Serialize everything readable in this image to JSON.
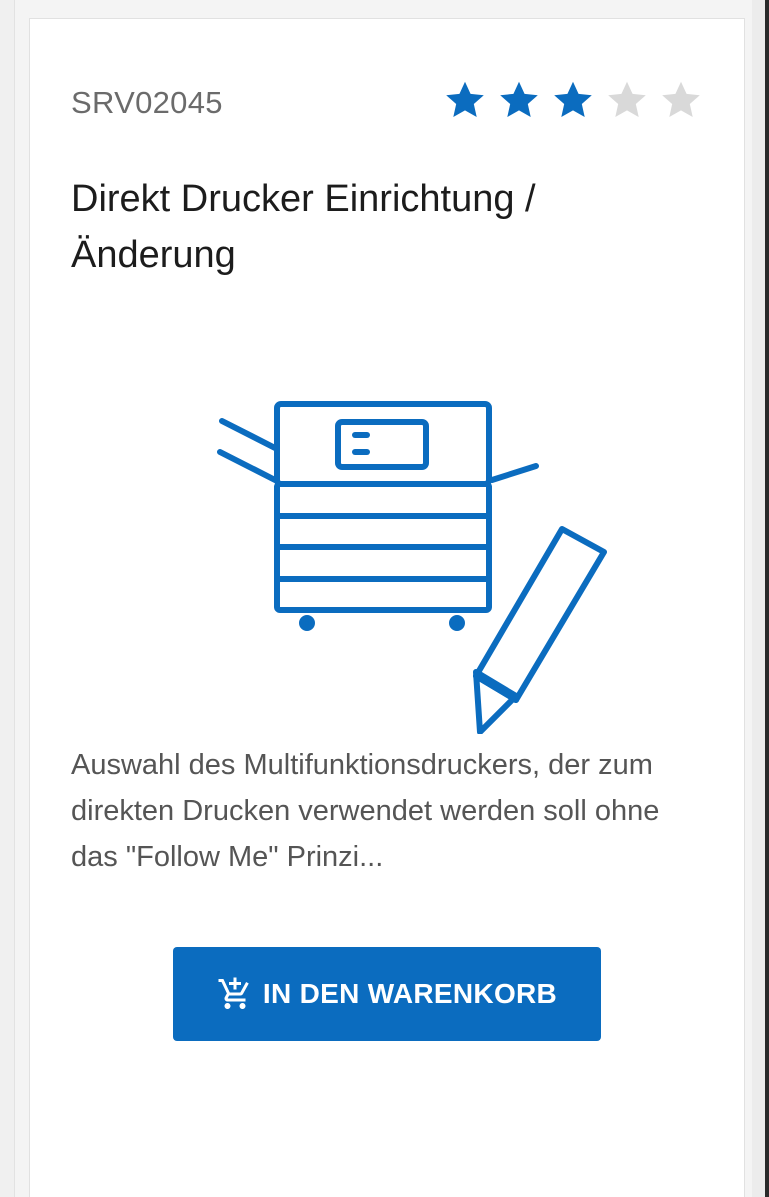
{
  "product": {
    "sku": "SRV02045",
    "title": "Direkt Drucker Einrichtung / Änderung",
    "rating": {
      "value": 3,
      "max": 5
    },
    "illustration_icon": "printer-with-pencil-icon",
    "description": "Auswahl des Multifunktionsdruckers, der zum direkten Drucken verwendet werden soll ohne das \"Follow Me\" Prinzi...",
    "cart_button_label": "IN DEN WARENKORB",
    "cart_button_icon": "add-to-cart-icon"
  },
  "colors": {
    "accent": "#0b6cbf",
    "star_filled": "#0b6cbf",
    "star_empty": "#d9d9d9",
    "text_primary": "#1c1c1c",
    "text_secondary": "#555555"
  }
}
